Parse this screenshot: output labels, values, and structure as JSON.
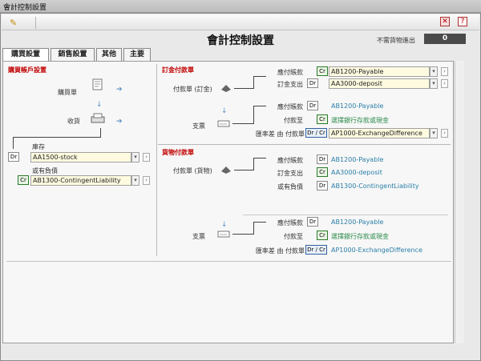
{
  "window": {
    "title": "會計控制設置"
  },
  "toolbar": {
    "edit_icon": "pencil-icon",
    "close_icon": "close-icon",
    "help_icon": "help-icon",
    "close_glyph": "✕",
    "help_glyph": "?"
  },
  "header": {
    "title": "會計控制設置",
    "no_ship_label": "不需貨物進出",
    "no_ship_value": "0"
  },
  "tabs": [
    {
      "label": "購買設置",
      "active": true
    },
    {
      "label": "銷售設置",
      "active": false
    },
    {
      "label": "其他",
      "active": false
    },
    {
      "label": "主要",
      "active": false
    }
  ],
  "left": {
    "section_title": "購買帳戶設置",
    "purchase_label": "購買單",
    "receive_label": "收貨",
    "inventory_label": "庫存",
    "inventory_tag": "Dr",
    "inventory_value": "AA1500-stock",
    "liability_label": "或有負債",
    "liability_tag": "Cr",
    "liability_value": "AB1300-ContingentLiability"
  },
  "deposit": {
    "section_title": "訂金付款單",
    "payment_label": "付款單 (訂金)",
    "cheque_label": "支票",
    "rows1": [
      {
        "label": "應付賬款",
        "tag": "Cr",
        "value": "AB1200-Payable"
      },
      {
        "label": "訂金支出",
        "tag": "Dr",
        "value": "AA3000-deposit"
      }
    ],
    "rows2": [
      {
        "label": "應付賬款",
        "tag": "Dr",
        "value": "AB1200-Payable"
      },
      {
        "label": "付款至",
        "tag": "Cr",
        "value": "選擇銀行存款或現金"
      },
      {
        "label": "匯率差 由 付款單",
        "tag": "Dr / Cr",
        "value": "AP1000-ExchangeDifference"
      }
    ]
  },
  "goods": {
    "section_title": "貨物付款單",
    "payment_label": "付款單 (貨物)",
    "cheque_label": "支票",
    "rows1": [
      {
        "label": "應付賬款",
        "tag": "Dr",
        "value": "AB1200-Payable"
      },
      {
        "label": "訂金支出",
        "tag": "Cr",
        "value": "AA3000-deposit"
      },
      {
        "label": "或有負債",
        "tag": "Dr",
        "value": "AB1300-ContingentLiability"
      }
    ],
    "rows2": [
      {
        "label": "應付賬款",
        "tag": "Dr",
        "value": "AB1200-Payable"
      },
      {
        "label": "付款至",
        "tag": "Cr",
        "value": "選擇銀行存款或現金"
      },
      {
        "label": "匯率差 由 付款單",
        "tag": "Dr / Cr",
        "value": "AP1000-ExchangeDifference"
      }
    ]
  },
  "glyphs": {
    "dropdown": "▾",
    "go": "›",
    "arrow_right": "➔",
    "arrow_down": "↓"
  }
}
